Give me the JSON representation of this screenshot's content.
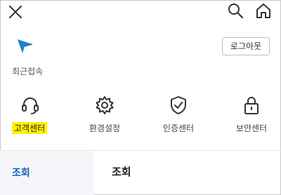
{
  "header": {
    "close_icon": "close-icon",
    "search_icon": "search-icon",
    "home_icon": "home-icon"
  },
  "recent": {
    "icon": "paper-plane-icon",
    "label": "최근접속",
    "icon_color": "#1a86c9"
  },
  "logout_label": "로그아웃",
  "menu": {
    "items": [
      {
        "label": "고객센터",
        "icon": "headset-icon",
        "highlighted": true
      },
      {
        "label": "환경설정",
        "icon": "gear-icon"
      },
      {
        "label": "인증센터",
        "icon": "shield-check-icon"
      },
      {
        "label": "보안센터",
        "icon": "lock-icon"
      }
    ]
  },
  "bottom": {
    "tab_label": "조회",
    "title": "조회"
  },
  "colors": {
    "highlight": "#fff200",
    "accent": "#1a5fb4"
  }
}
